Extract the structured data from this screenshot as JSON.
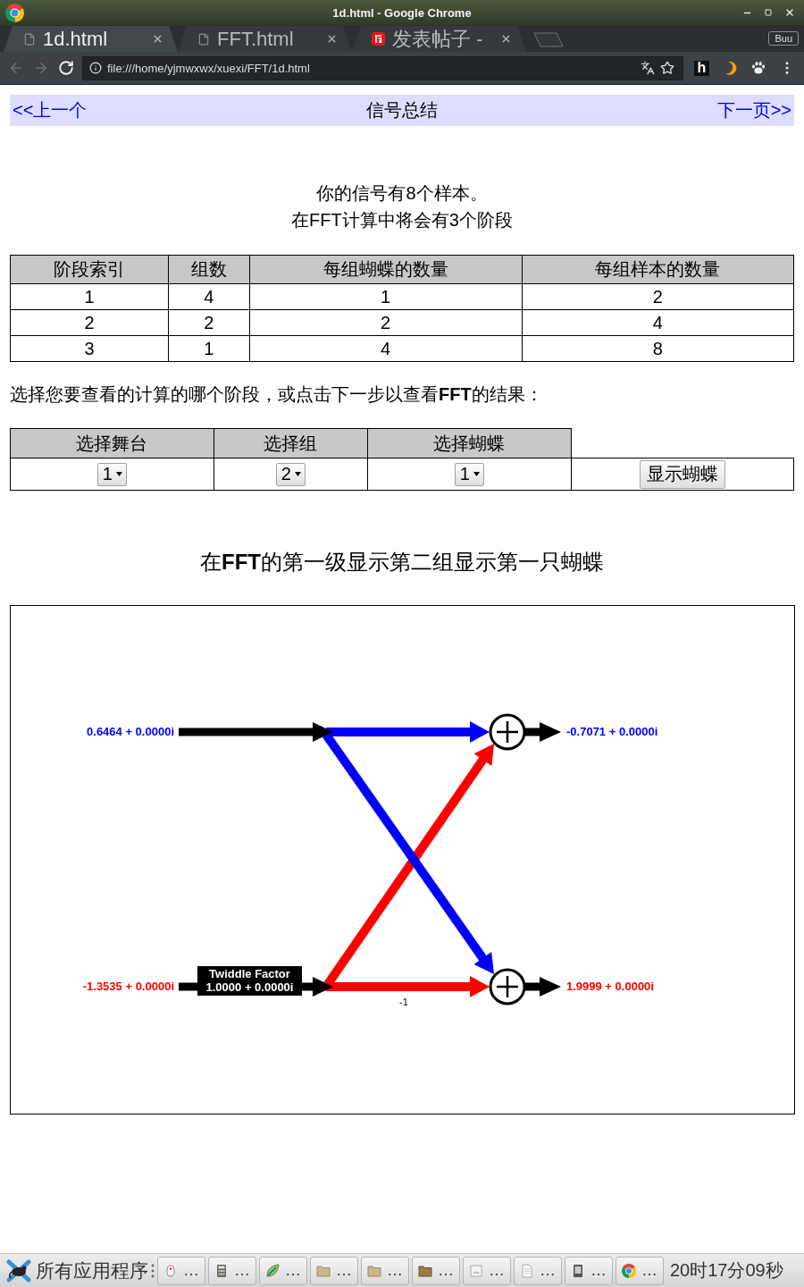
{
  "browser": {
    "title": "1d.html - Google Chrome",
    "tabs": [
      {
        "label": "1d.html",
        "kind": "file",
        "selected": true
      },
      {
        "label": "FFT.html",
        "kind": "file",
        "selected": false
      },
      {
        "label": "发表帖子 -",
        "kind": "site",
        "selected": false
      }
    ],
    "profile": "Buu",
    "back": {
      "disabled": true
    },
    "forward": {
      "disabled": true
    },
    "url": "file:///home/yjmwxwx/xuexi/FFT/1d.html",
    "extensions": [
      {
        "kind": "letter",
        "text": "h"
      },
      {
        "kind": "crescent"
      },
      {
        "kind": "paw"
      }
    ]
  },
  "nav": {
    "previous": "<<上一个",
    "title": "信号总结",
    "next": "下一页>>"
  },
  "summary": [
    "你的信号有8个样本。",
    "在FFT计算中将会有3个阶段"
  ],
  "stages_table": {
    "columns": [
      "阶段索引",
      "组数",
      "每组蝴蝶的数量",
      "每组样本的数量"
    ],
    "rows": [
      [
        "1",
        "4",
        "1",
        "2"
      ],
      [
        "2",
        "2",
        "2",
        "4"
      ],
      [
        "3",
        "1",
        "4",
        "8"
      ]
    ]
  },
  "instruction": "选择您要查看的计算的哪个阶段，或点击下一步以查看**FFT**的结果：",
  "selector": {
    "columns": [
      "选择舞台",
      "选择组",
      "选择蝴蝶"
    ],
    "selects": [
      "1",
      "2",
      "1"
    ],
    "button": "显示蝴蝶"
  },
  "heading": "在**FFT**的第一级显示第二组显示第一只蝴蝶",
  "butterfly": {
    "inputs": [
      {
        "value": "0.6464 + 0.0000i",
        "color": "#0000ff"
      },
      {
        "value": "-1.3535 + 0.0000i",
        "color": "#ff0000"
      }
    ],
    "outputs": [
      {
        "value": "-0.7071 + 0.0000i",
        "color": "#0000ff"
      },
      {
        "value": "1.9999 + 0.0000i",
        "color": "#ff0000"
      }
    ],
    "twiddle_factor": {
      "title": "Twiddle Factor",
      "value": "1.0000 + 0.0000i"
    },
    "negation": "-1"
  },
  "taskbar": {
    "start": "所有应用程序",
    "tasks": [
      {
        "kind": "device",
        "label": "…"
      },
      {
        "kind": "calculator",
        "label": "…"
      },
      {
        "kind": "editor",
        "label": "…"
      },
      {
        "kind": "folder",
        "label": "…"
      },
      {
        "kind": "folder",
        "label": "…"
      },
      {
        "kind": "openfolder",
        "label": "…"
      },
      {
        "kind": "image",
        "label": "…"
      },
      {
        "kind": "document",
        "label": "…"
      },
      {
        "kind": "reader",
        "label": "…"
      },
      {
        "kind": "browser",
        "label": "…"
      }
    ],
    "clock": "20时17分09秒"
  }
}
